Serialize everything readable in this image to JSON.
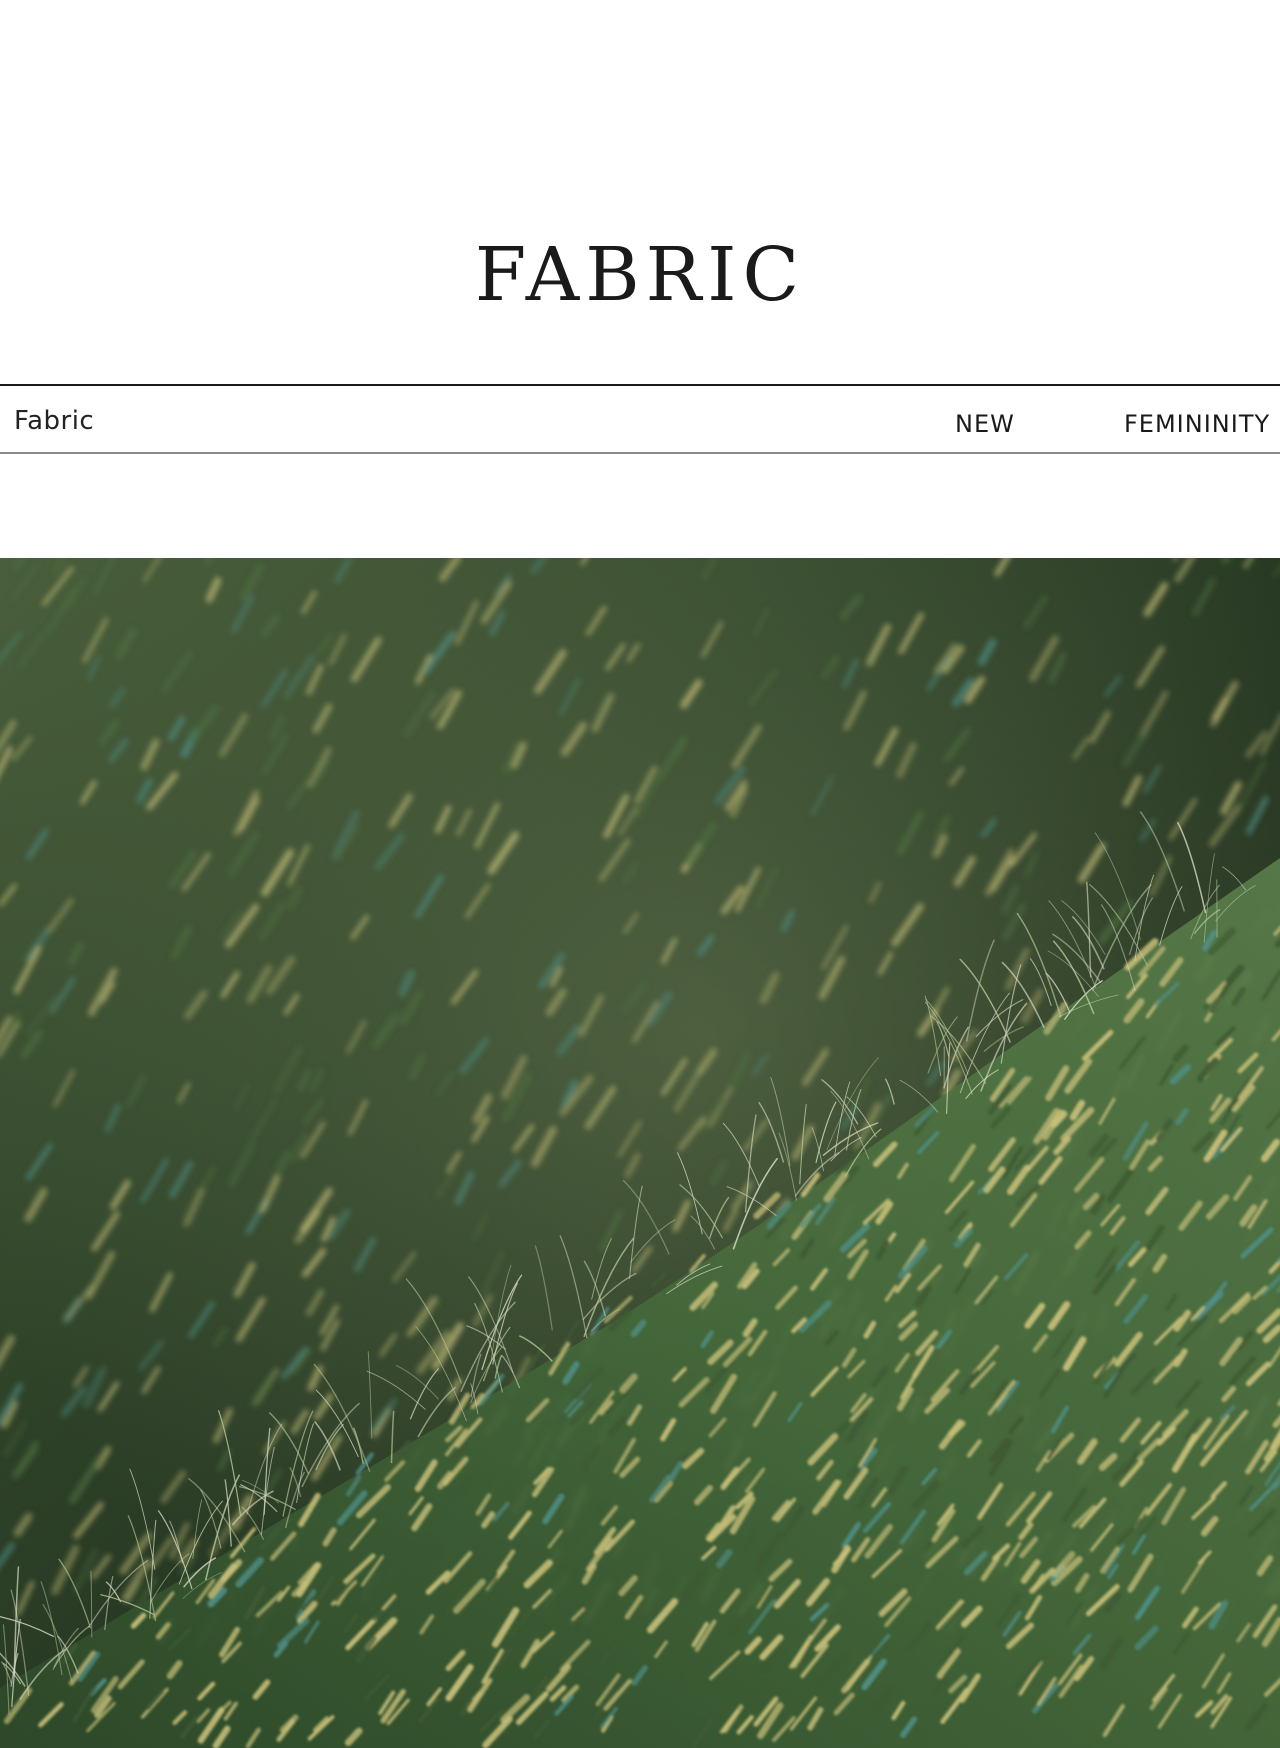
{
  "page": {
    "title": "FABRIC"
  },
  "nav": {
    "section_label": "Fabric",
    "links": [
      {
        "label": "NEW"
      },
      {
        "label": "FEMININITY"
      }
    ]
  },
  "hero": {
    "image_alt": "",
    "colors": {
      "deep": "#1f2a1c",
      "moss": "#3f5a34",
      "green": "#4e7040",
      "yarn": "#c9c07a",
      "teal": "#4f8f86"
    }
  }
}
